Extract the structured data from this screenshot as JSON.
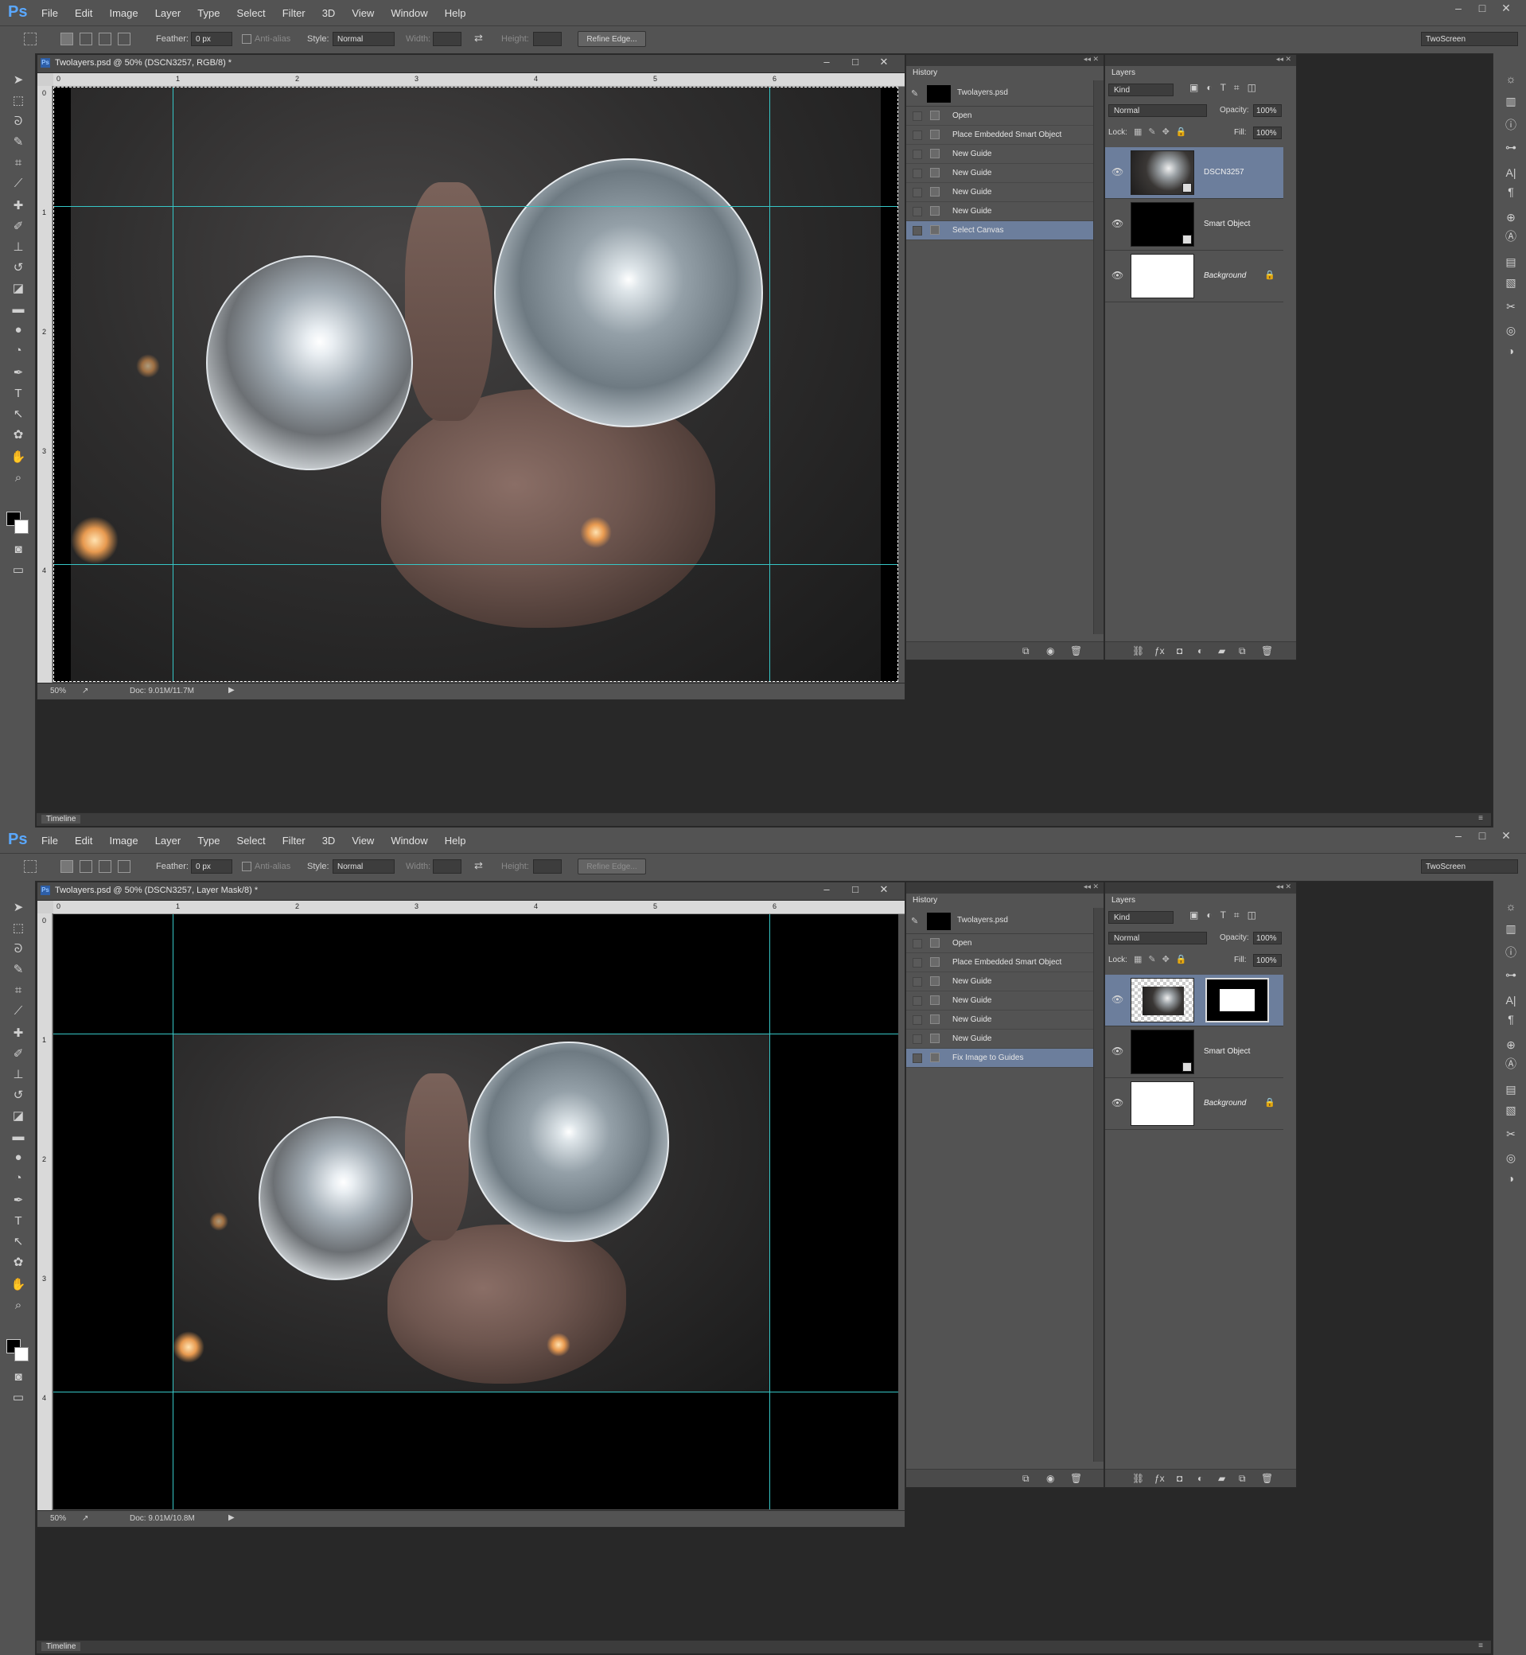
{
  "app": {
    "logo": "Ps",
    "menu": [
      "File",
      "Edit",
      "Image",
      "Layer",
      "Type",
      "Select",
      "Filter",
      "3D",
      "View",
      "Window",
      "Help"
    ],
    "window_controls": [
      "–",
      "□",
      "✕"
    ]
  },
  "options": {
    "feather_label": "Feather:",
    "feather_value": "0 px",
    "antialias_label": "Anti-alias",
    "style_label": "Style:",
    "style_value": "Normal",
    "width_label": "Width:",
    "height_label": "Height:",
    "refine_label": "Refine Edge...",
    "workspace": "TwoScreen"
  },
  "ruler": {
    "marks": [
      "0",
      "1",
      "2",
      "3",
      "4",
      "5",
      "6"
    ],
    "vmarks": [
      "0",
      "1",
      "2",
      "3",
      "4"
    ]
  },
  "panels": {
    "history_tab": "History",
    "layers_tab": "Layers",
    "timeline": "Timeline"
  },
  "screen1": {
    "doc_title": "Twolayers.psd @ 50% (DSCN3257, RGB/8) *",
    "zoom": "50%",
    "doc_info": "Doc: 9.01M/11.7M",
    "history": {
      "snapshot": "Twolayers.psd",
      "items": [
        "Open",
        "Place Embedded Smart Object",
        "New Guide",
        "New Guide",
        "New Guide",
        "New Guide",
        "Select Canvas"
      ],
      "selected": 6
    }
  },
  "screen2": {
    "doc_title": "Twolayers.psd @ 50% (DSCN3257, Layer Mask/8) *",
    "zoom": "50%",
    "doc_info": "Doc: 9.01M/10.8M",
    "history": {
      "snapshot": "Twolayers.psd",
      "items": [
        "Open",
        "Place Embedded Smart Object",
        "New Guide",
        "New Guide",
        "New Guide",
        "New Guide",
        "Fix Image to Guides"
      ],
      "selected": 6
    }
  },
  "layers": {
    "kind": "Kind",
    "blend": "Normal",
    "opacity_label": "Opacity:",
    "opacity": "100%",
    "lock_label": "Lock:",
    "fill_label": "Fill:",
    "fill": "100%",
    "items": [
      {
        "name": "DSCN3257",
        "selected": true
      },
      {
        "name": "Smart Object",
        "selected": false
      },
      {
        "name": "Background",
        "selected": false
      }
    ]
  },
  "colors": {
    "guide": "#36c6c6",
    "selection": "#6c7e9c",
    "panel": "#535353",
    "background": "#282828"
  }
}
